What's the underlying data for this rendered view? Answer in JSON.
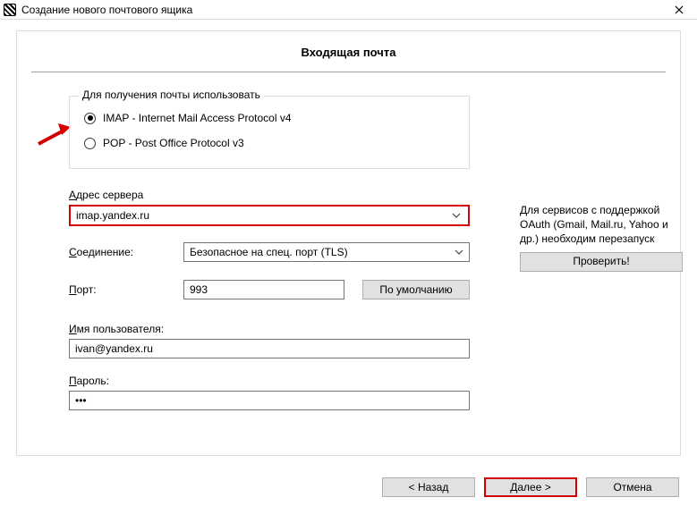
{
  "window": {
    "title": "Создание нового почтового ящика"
  },
  "heading": "Входящая почта",
  "fieldset": {
    "legend": "Для получения почты использовать",
    "options": {
      "imap": "IMAP - Internet Mail Access Protocol v4",
      "pop": "POP  - Post Office Protocol v3"
    },
    "selected": "imap"
  },
  "server": {
    "label_pre": "А",
    "label_post": "дрес сервера",
    "value": "imap.yandex.ru"
  },
  "oauth_note": "Для сервисов с поддержкой OAuth (Gmail, Mail.ru, Yahoo и др.) необходим перезапуск",
  "check_button": "Проверить!",
  "connection": {
    "label_pre": "С",
    "label_post": "оединение:",
    "value": "Безопасное на спец. порт (TLS)"
  },
  "port": {
    "label_pre": "П",
    "label_post": "орт:",
    "value": "993",
    "default_button": "По умолчанию"
  },
  "username": {
    "label_pre": "И",
    "label_post": "мя пользователя:",
    "value": "ivan@yandex.ru"
  },
  "password": {
    "label_pre": "П",
    "label_post": "ароль:",
    "value": "•••"
  },
  "footer": {
    "back": "<  Назад",
    "next": "Далее  >",
    "cancel": "Отмена"
  }
}
